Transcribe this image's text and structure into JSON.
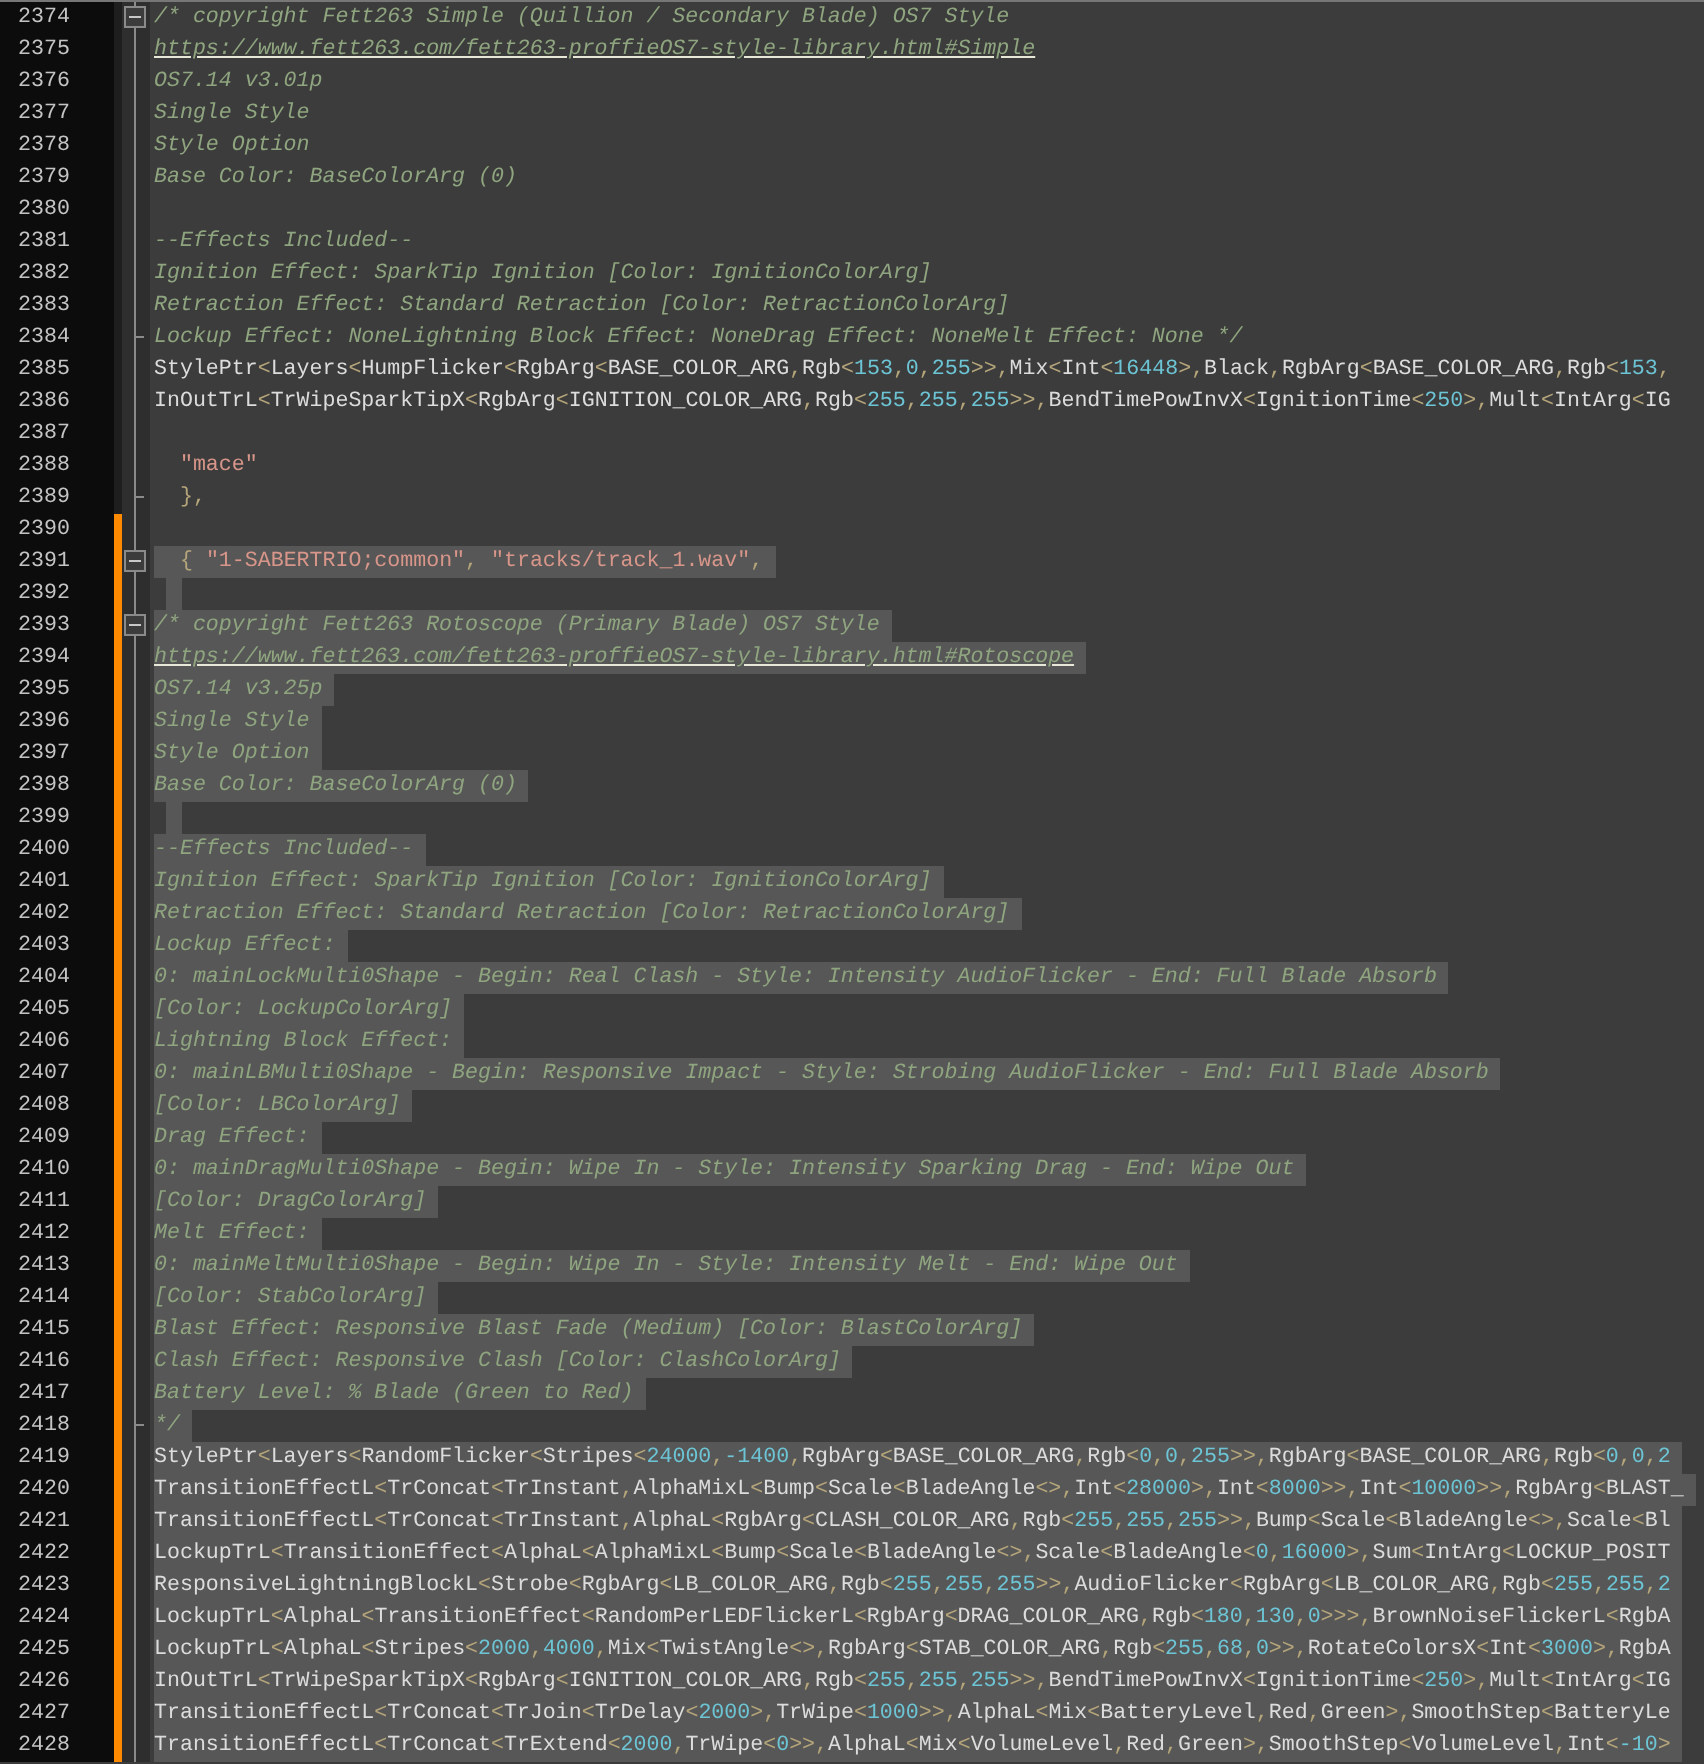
{
  "editor": {
    "lines": [
      {
        "number": "2374",
        "kind": "comment",
        "text": "/* copyright Fett263 Simple (Quillion / Secondary Blade) OS7 Style",
        "fold_start": true,
        "fold_end": false,
        "selected": false,
        "changed": false
      },
      {
        "number": "2375",
        "kind": "link",
        "text": "https://www.fett263.com/fett263-proffieOS7-style-library.html#Simple",
        "fold_start": false,
        "fold_end": false,
        "selected": false,
        "changed": false
      },
      {
        "number": "2376",
        "kind": "comment",
        "text": "OS7.14 v3.01p",
        "fold_start": false,
        "fold_end": false,
        "selected": false,
        "changed": false
      },
      {
        "number": "2377",
        "kind": "comment",
        "text": "Single Style",
        "fold_start": false,
        "fold_end": false,
        "selected": false,
        "changed": false
      },
      {
        "number": "2378",
        "kind": "comment",
        "text": "Style Option",
        "fold_start": false,
        "fold_end": false,
        "selected": false,
        "changed": false
      },
      {
        "number": "2379",
        "kind": "comment",
        "text": "Base Color: BaseColorArg (0)",
        "fold_start": false,
        "fold_end": false,
        "selected": false,
        "changed": false
      },
      {
        "number": "2380",
        "kind": "comment",
        "fold_start": false,
        "fold_end": false,
        "selected": false,
        "changed": false
      },
      {
        "number": "2381",
        "kind": "comment",
        "text": "--Effects Included--",
        "fold_start": false,
        "fold_end": false,
        "selected": false,
        "changed": false
      },
      {
        "number": "2382",
        "kind": "comment",
        "text": "Ignition Effect: SparkTip Ignition [Color: IgnitionColorArg]",
        "fold_start": false,
        "fold_end": false,
        "selected": false,
        "changed": false
      },
      {
        "number": "2383",
        "kind": "comment",
        "text": "Retraction Effect: Standard Retraction [Color: RetractionColorArg]",
        "fold_start": false,
        "fold_end": false,
        "selected": false,
        "changed": false
      },
      {
        "number": "2384",
        "kind": "comment",
        "text": "Lockup Effect: NoneLightning Block Effect: NoneDrag Effect: NoneMelt Effect: None */",
        "fold_start": false,
        "fold_end": true,
        "selected": false,
        "changed": false
      },
      {
        "number": "2385",
        "kind": "code",
        "text": "StylePtr<Layers<HumpFlicker<RgbArg<BASE_COLOR_ARG,Rgb<153,0,255>>,Mix<Int<16448>,Black,RgbArg<BASE_COLOR_ARG,Rgb<153,",
        "fold_start": false,
        "fold_end": false,
        "selected": false,
        "changed": false
      },
      {
        "number": "2386",
        "kind": "code",
        "text": "InOutTrL<TrWipeSparkTipX<RgbArg<IGNITION_COLOR_ARG,Rgb<255,255,255>>,BendTimePowInvX<IgnitionTime<250>,Mult<IntArg<IG",
        "fold_start": false,
        "fold_end": false,
        "selected": false,
        "changed": false
      },
      {
        "number": "2387",
        "kind": "code",
        "fold_start": false,
        "fold_end": false,
        "selected": false,
        "changed": false
      },
      {
        "number": "2388",
        "kind": "code",
        "text": "  \"mace\"",
        "fold_start": false,
        "fold_end": false,
        "selected": false,
        "changed": false
      },
      {
        "number": "2389",
        "kind": "code",
        "text": "  },",
        "fold_start": false,
        "fold_end": true,
        "selected": false,
        "changed": false
      },
      {
        "number": "2390",
        "kind": "code",
        "fold_start": false,
        "fold_end": false,
        "selected": false,
        "changed": true
      },
      {
        "number": "2391",
        "kind": "code",
        "text": "  { \"1-SABERTRIO;common\", \"tracks/track_1.wav\",",
        "fold_start": true,
        "fold_end": false,
        "selected": true,
        "changed": true
      },
      {
        "number": "2392",
        "kind": "code",
        "fold_start": false,
        "fold_end": false,
        "selected": true,
        "changed": true
      },
      {
        "number": "2393",
        "kind": "comment",
        "text": "/* copyright Fett263 Rotoscope (Primary Blade) OS7 Style",
        "fold_start": true,
        "fold_end": false,
        "selected": true,
        "changed": true
      },
      {
        "number": "2394",
        "kind": "link",
        "text": "https://www.fett263.com/fett263-proffieOS7-style-library.html#Rotoscope",
        "fold_start": false,
        "fold_end": false,
        "selected": true,
        "changed": true
      },
      {
        "number": "2395",
        "kind": "comment",
        "text": "OS7.14 v3.25p",
        "fold_start": false,
        "fold_end": false,
        "selected": true,
        "changed": true
      },
      {
        "number": "2396",
        "kind": "comment",
        "text": "Single Style",
        "fold_start": false,
        "fold_end": false,
        "selected": true,
        "changed": true
      },
      {
        "number": "2397",
        "kind": "comment",
        "text": "Style Option",
        "fold_start": false,
        "fold_end": false,
        "selected": true,
        "changed": true
      },
      {
        "number": "2398",
        "kind": "comment",
        "text": "Base Color: BaseColorArg (0)",
        "fold_start": false,
        "fold_end": false,
        "selected": true,
        "changed": true
      },
      {
        "number": "2399",
        "kind": "comment",
        "fold_start": false,
        "fold_end": false,
        "selected": true,
        "changed": true
      },
      {
        "number": "2400",
        "kind": "comment",
        "text": "--Effects Included--",
        "fold_start": false,
        "fold_end": false,
        "selected": true,
        "changed": true
      },
      {
        "number": "2401",
        "kind": "comment",
        "text": "Ignition Effect: SparkTip Ignition [Color: IgnitionColorArg]",
        "fold_start": false,
        "fold_end": false,
        "selected": true,
        "changed": true
      },
      {
        "number": "2402",
        "kind": "comment",
        "text": "Retraction Effect: Standard Retraction [Color: RetractionColorArg]",
        "fold_start": false,
        "fold_end": false,
        "selected": true,
        "changed": true
      },
      {
        "number": "2403",
        "kind": "comment",
        "text": "Lockup Effect:",
        "fold_start": false,
        "fold_end": false,
        "selected": true,
        "changed": true
      },
      {
        "number": "2404",
        "kind": "comment",
        "text": "0: mainLockMulti0Shape - Begin: Real Clash - Style: Intensity AudioFlicker - End: Full Blade Absorb",
        "fold_start": false,
        "fold_end": false,
        "selected": true,
        "changed": true
      },
      {
        "number": "2405",
        "kind": "comment",
        "text": "[Color: LockupColorArg]",
        "fold_start": false,
        "fold_end": false,
        "selected": true,
        "changed": true
      },
      {
        "number": "2406",
        "kind": "comment",
        "text": "Lightning Block Effect:",
        "fold_start": false,
        "fold_end": false,
        "selected": true,
        "changed": true
      },
      {
        "number": "2407",
        "kind": "comment",
        "text": "0: mainLBMulti0Shape - Begin: Responsive Impact - Style: Strobing AudioFlicker - End: Full Blade Absorb",
        "fold_start": false,
        "fold_end": false,
        "selected": true,
        "changed": true
      },
      {
        "number": "2408",
        "kind": "comment",
        "text": "[Color: LBColorArg]",
        "fold_start": false,
        "fold_end": false,
        "selected": true,
        "changed": true
      },
      {
        "number": "2409",
        "kind": "comment",
        "text": "Drag Effect:",
        "fold_start": false,
        "fold_end": false,
        "selected": true,
        "changed": true
      },
      {
        "number": "2410",
        "kind": "comment",
        "text": "0: mainDragMulti0Shape - Begin: Wipe In - Style: Intensity Sparking Drag - End: Wipe Out",
        "fold_start": false,
        "fold_end": false,
        "selected": true,
        "changed": true
      },
      {
        "number": "2411",
        "kind": "comment",
        "text": "[Color: DragColorArg]",
        "fold_start": false,
        "fold_end": false,
        "selected": true,
        "changed": true
      },
      {
        "number": "2412",
        "kind": "comment",
        "text": "Melt Effect:",
        "fold_start": false,
        "fold_end": false,
        "selected": true,
        "changed": true
      },
      {
        "number": "2413",
        "kind": "comment",
        "text": "0: mainMeltMulti0Shape - Begin: Wipe In - Style: Intensity Melt - End: Wipe Out",
        "fold_start": false,
        "fold_end": false,
        "selected": true,
        "changed": true
      },
      {
        "number": "2414",
        "kind": "comment",
        "text": "[Color: StabColorArg]",
        "fold_start": false,
        "fold_end": false,
        "selected": true,
        "changed": true
      },
      {
        "number": "2415",
        "kind": "comment",
        "text": "Blast Effect: Responsive Blast Fade (Medium) [Color: BlastColorArg]",
        "fold_start": false,
        "fold_end": false,
        "selected": true,
        "changed": true
      },
      {
        "number": "2416",
        "kind": "comment",
        "text": "Clash Effect: Responsive Clash [Color: ClashColorArg]",
        "fold_start": false,
        "fold_end": false,
        "selected": true,
        "changed": true
      },
      {
        "number": "2417",
        "kind": "comment",
        "text": "Battery Level: % Blade (Green to Red)",
        "fold_start": false,
        "fold_end": false,
        "selected": true,
        "changed": true
      },
      {
        "number": "2418",
        "kind": "comment",
        "text": "*/",
        "fold_start": false,
        "fold_end": true,
        "selected": true,
        "changed": true
      },
      {
        "number": "2419",
        "kind": "code",
        "text": "StylePtr<Layers<RandomFlicker<Stripes<24000,-1400,RgbArg<BASE_COLOR_ARG,Rgb<0,0,255>>,RgbArg<BASE_COLOR_ARG,Rgb<0,0,2",
        "fold_start": false,
        "fold_end": false,
        "selected": true,
        "changed": true
      },
      {
        "number": "2420",
        "kind": "code",
        "text": "TransitionEffectL<TrConcat<TrInstant,AlphaMixL<Bump<Scale<BladeAngle<>,Int<28000>,Int<8000>>,Int<10000>>,RgbArg<BLAST_",
        "fold_start": false,
        "fold_end": false,
        "selected": true,
        "changed": true
      },
      {
        "number": "2421",
        "kind": "code",
        "text": "TransitionEffectL<TrConcat<TrInstant,AlphaL<RgbArg<CLASH_COLOR_ARG,Rgb<255,255,255>>,Bump<Scale<BladeAngle<>,Scale<Bl",
        "fold_start": false,
        "fold_end": false,
        "selected": true,
        "changed": true
      },
      {
        "number": "2422",
        "kind": "code",
        "text": "LockupTrL<TransitionEffect<AlphaL<AlphaMixL<Bump<Scale<BladeAngle<>,Scale<BladeAngle<0,16000>,Sum<IntArg<LOCKUP_POSIT",
        "fold_start": false,
        "fold_end": false,
        "selected": true,
        "changed": true
      },
      {
        "number": "2423",
        "kind": "code",
        "text": "ResponsiveLightningBlockL<Strobe<RgbArg<LB_COLOR_ARG,Rgb<255,255,255>>,AudioFlicker<RgbArg<LB_COLOR_ARG,Rgb<255,255,2",
        "fold_start": false,
        "fold_end": false,
        "selected": true,
        "changed": true
      },
      {
        "number": "2424",
        "kind": "code",
        "text": "LockupTrL<AlphaL<TransitionEffect<RandomPerLEDFlickerL<RgbArg<DRAG_COLOR_ARG,Rgb<180,130,0>>>,BrownNoiseFlickerL<RgbA",
        "fold_start": false,
        "fold_end": false,
        "selected": true,
        "changed": true
      },
      {
        "number": "2425",
        "kind": "code",
        "text": "LockupTrL<AlphaL<Stripes<2000,4000,Mix<TwistAngle<>,RgbArg<STAB_COLOR_ARG,Rgb<255,68,0>>,RotateColorsX<Int<3000>,RgbA",
        "fold_start": false,
        "fold_end": false,
        "selected": true,
        "changed": true
      },
      {
        "number": "2426",
        "kind": "code",
        "text": "InOutTrL<TrWipeSparkTipX<RgbArg<IGNITION_COLOR_ARG,Rgb<255,255,255>>,BendTimePowInvX<IgnitionTime<250>,Mult<IntArg<IG",
        "fold_start": false,
        "fold_end": false,
        "selected": true,
        "changed": true
      },
      {
        "number": "2427",
        "kind": "code",
        "text": "TransitionEffectL<TrConcat<TrJoin<TrDelay<2000>,TrWipe<1000>>,AlphaL<Mix<BatteryLevel,Red,Green>,SmoothStep<BatteryLe",
        "fold_start": false,
        "fold_end": false,
        "selected": true,
        "changed": true
      },
      {
        "number": "2428",
        "kind": "code",
        "text": "TransitionEffectL<TrConcat<TrExtend<2000,TrWipe<0>>,AlphaL<Mix<VolumeLevel,Red,Green>,SmoothStep<VolumeLevel,Int<-10>",
        "fold_start": false,
        "fold_end": false,
        "selected": true,
        "changed": true
      }
    ]
  }
}
